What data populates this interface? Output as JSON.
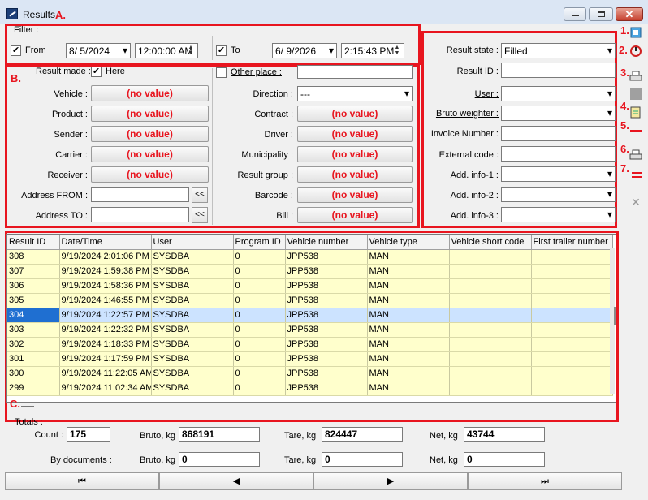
{
  "window": {
    "title": "Results"
  },
  "annotations": {
    "a": "A.",
    "b": "B.",
    "c": "C.",
    "t1": "1.",
    "t2": "2.",
    "t3": "3.",
    "t4": "4.",
    "t5": "5.",
    "t6": "6.",
    "t7": "7."
  },
  "filter": {
    "label": "Filter :",
    "from_label": "From",
    "from_checked": true,
    "from_date": "8/ 5/2024",
    "from_time": "12:00:00 AM",
    "to_label": "To",
    "to_checked": true,
    "to_date": "6/ 9/2026",
    "to_time": "2:15:43 PM"
  },
  "left": {
    "result_made_label": "Result made :",
    "here_label": "Here",
    "here_checked": true,
    "other_place_label": "Other place :",
    "fields": [
      {
        "label": "Vehicle :",
        "value": "(no value)"
      },
      {
        "label": "Product :",
        "value": "(no value)"
      },
      {
        "label": "Sender :",
        "value": "(no value)"
      },
      {
        "label": "Carrier :",
        "value": "(no value)"
      },
      {
        "label": "Receiver :",
        "value": "(no value)"
      }
    ],
    "address_from_label": "Address FROM :",
    "address_to_label": "Address TO :",
    "addr_btn": "<<"
  },
  "middle": {
    "direction_label": "Direction :",
    "direction_value": "---",
    "fields": [
      {
        "label": "Contract :",
        "value": "(no value)"
      },
      {
        "label": "Driver :",
        "value": "(no value)"
      },
      {
        "label": "Municipality :",
        "value": "(no value)"
      },
      {
        "label": "Result group :",
        "value": "(no value)"
      },
      {
        "label": "Barcode :",
        "value": "(no value)"
      },
      {
        "label": "Bill :",
        "value": "(no value)"
      }
    ]
  },
  "right": {
    "result_state_label": "Result state :",
    "result_state_value": "Filled",
    "result_id_label": "Result ID :",
    "user_label": "User :",
    "bruto_weighter_label": "Bruto weighter :",
    "invoice_label": "Invoice Number :",
    "external_label": "External code :",
    "info1_label": "Add. info-1 :",
    "info2_label": "Add. info-2 :",
    "info3_label": "Add. info-3 :"
  },
  "table": {
    "columns": [
      "Result ID",
      "Date/Time",
      "User",
      "Program ID",
      "Vehicle number",
      "Vehicle type",
      "Vehicle short code",
      "First trailer number"
    ],
    "rows": [
      [
        "308",
        "9/19/2024 2:01:06 PM",
        "SYSDBA",
        "0",
        "JPP538",
        "MAN",
        "",
        ""
      ],
      [
        "307",
        "9/19/2024 1:59:38 PM",
        "SYSDBA",
        "0",
        "JPP538",
        "MAN",
        "",
        ""
      ],
      [
        "306",
        "9/19/2024 1:58:36 PM",
        "SYSDBA",
        "0",
        "JPP538",
        "MAN",
        "",
        ""
      ],
      [
        "305",
        "9/19/2024 1:46:55 PM",
        "SYSDBA",
        "0",
        "JPP538",
        "MAN",
        "",
        ""
      ],
      [
        "304",
        "9/19/2024 1:22:57 PM",
        "SYSDBA",
        "0",
        "JPP538",
        "MAN",
        "",
        ""
      ],
      [
        "303",
        "9/19/2024 1:22:32 PM",
        "SYSDBA",
        "0",
        "JPP538",
        "MAN",
        "",
        ""
      ],
      [
        "302",
        "9/19/2024 1:18:33 PM",
        "SYSDBA",
        "0",
        "JPP538",
        "MAN",
        "",
        ""
      ],
      [
        "301",
        "9/19/2024 1:17:59 PM",
        "SYSDBA",
        "0",
        "JPP538",
        "MAN",
        "",
        ""
      ],
      [
        "300",
        "9/19/2024 11:22:05 AM",
        "SYSDBA",
        "0",
        "JPP538",
        "MAN",
        "",
        ""
      ],
      [
        "299",
        "9/19/2024 11:02:34 AM",
        "SYSDBA",
        "0",
        "JPP538",
        "MAN",
        "",
        ""
      ]
    ],
    "selected_row": 4
  },
  "totals": {
    "label": "Totals :",
    "count_label": "Count :",
    "count": "175",
    "bruto_label": "Bruto, kg",
    "bruto": "868191",
    "tare_label": "Tare, kg",
    "tare": "824447",
    "net_label": "Net, kg",
    "net": "43744",
    "docs_label": "By documents :",
    "docs_bruto": "0",
    "docs_tare": "0",
    "docs_net": "0"
  },
  "nav": {
    "first": "⏮",
    "prev": "◀",
    "next": "▶",
    "last": "⏭"
  },
  "toolbar_icons": [
    "select-icon",
    "refresh-icon",
    "print-icon",
    "stop-icon",
    "export-icon",
    "delete-icon",
    "print-preview-icon",
    "delete-all-icon",
    "close-grid-icon"
  ],
  "colors": {
    "annotation": "#e8151f",
    "selected_row": "#cce3ff",
    "row": "#ffffcc"
  }
}
